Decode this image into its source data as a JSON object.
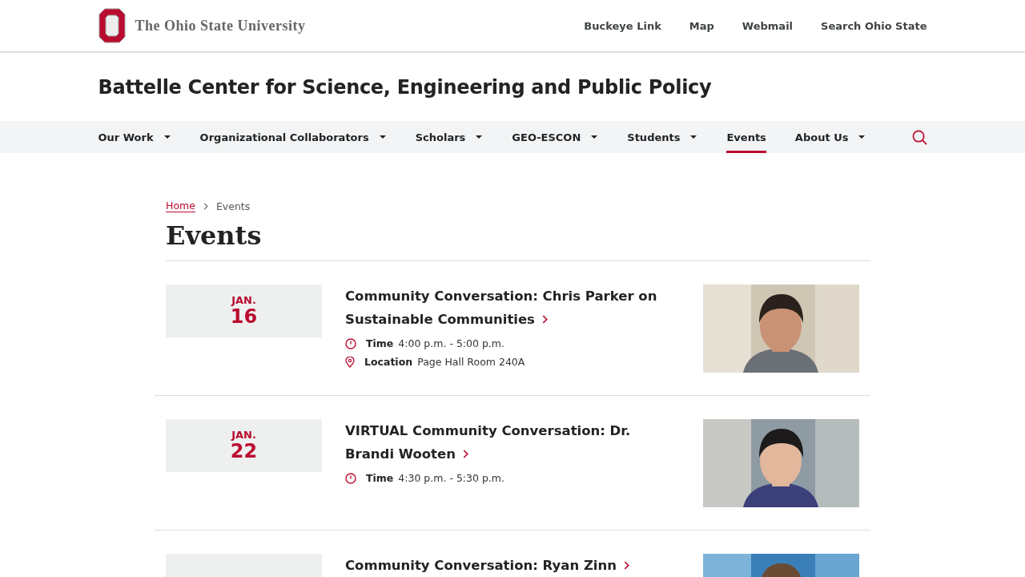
{
  "header": {
    "university": "The Ohio State University",
    "links": [
      "Buckeye Link",
      "Map",
      "Webmail",
      "Search Ohio State"
    ]
  },
  "site_title": "Battelle Center for Science, Engineering and Public Policy",
  "nav": [
    {
      "label": "Our Work",
      "dropdown": true,
      "selected": false
    },
    {
      "label": "Organizational Collaborators",
      "dropdown": true,
      "selected": false
    },
    {
      "label": "Scholars",
      "dropdown": true,
      "selected": false
    },
    {
      "label": "GEO-ESCON",
      "dropdown": true,
      "selected": false
    },
    {
      "label": "Students",
      "dropdown": true,
      "selected": false
    },
    {
      "label": "Events",
      "dropdown": false,
      "selected": true
    },
    {
      "label": "About Us",
      "dropdown": true,
      "selected": false
    }
  ],
  "breadcrumb": [
    "Home",
    "Events"
  ],
  "page_title": "Events",
  "events": [
    {
      "month": "JAN.",
      "day": "16",
      "title": "Community Conversation: Chris Parker on Sustainable Communities",
      "details": [
        {
          "kind": "time",
          "label": "Time",
          "value": "4:00 p.m. - 5:00 p.m."
        },
        {
          "kind": "location",
          "label": "Location",
          "value": "Page Hall Room 240A"
        }
      ],
      "image": {
        "kind": "picture"
      }
    },
    {
      "month": "JAN.",
      "day": "22",
      "title": "VIRTUAL Community Conversation: Dr. Brandi Wooten",
      "details": [
        {
          "kind": "time",
          "label": "Time",
          "value": "4:30 p.m. - 5:30 p.m."
        }
      ],
      "image": {
        "kind": "picture"
      }
    },
    {
      "title": "Community Conversation: Ryan Zinn",
      "image": {
        "kind": "picture"
      }
    }
  ]
}
